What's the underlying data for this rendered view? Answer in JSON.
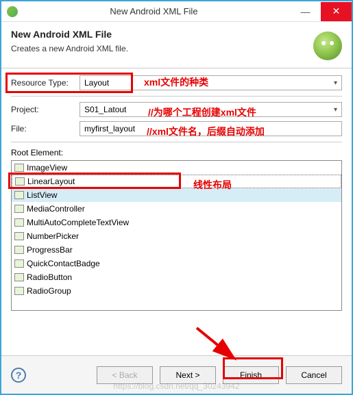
{
  "window": {
    "title": "New Android XML File"
  },
  "header": {
    "title": "New Android XML File",
    "desc": "Creates a new Android XML file."
  },
  "fields": {
    "resourceType": {
      "label": "Resource Type:",
      "value": "Layout"
    },
    "project": {
      "label": "Project:",
      "value": "S01_Latout"
    },
    "file": {
      "label": "File:",
      "value": "myfirst_layout"
    },
    "rootElement": {
      "label": "Root Element:"
    }
  },
  "rootItems": [
    {
      "name": "ImageView"
    },
    {
      "name": "LinearLayout"
    },
    {
      "name": "ListView"
    },
    {
      "name": "MediaController"
    },
    {
      "name": "MultiAutoCompleteTextView"
    },
    {
      "name": "NumberPicker"
    },
    {
      "name": "ProgressBar"
    },
    {
      "name": "QuickContactBadge"
    },
    {
      "name": "RadioButton"
    },
    {
      "name": "RadioGroup"
    }
  ],
  "buttons": {
    "back": "< Back",
    "next": "Next >",
    "finish": "Finish",
    "cancel": "Cancel"
  },
  "annotations": {
    "resourceType": "xml文件的种类",
    "project": "//为哪个工程创建xml文件",
    "file": "//xml文件名，后缀自动添加",
    "linearLayout": "线性布局"
  },
  "watermark": "https://blog.csdn.net/qq_30243942"
}
